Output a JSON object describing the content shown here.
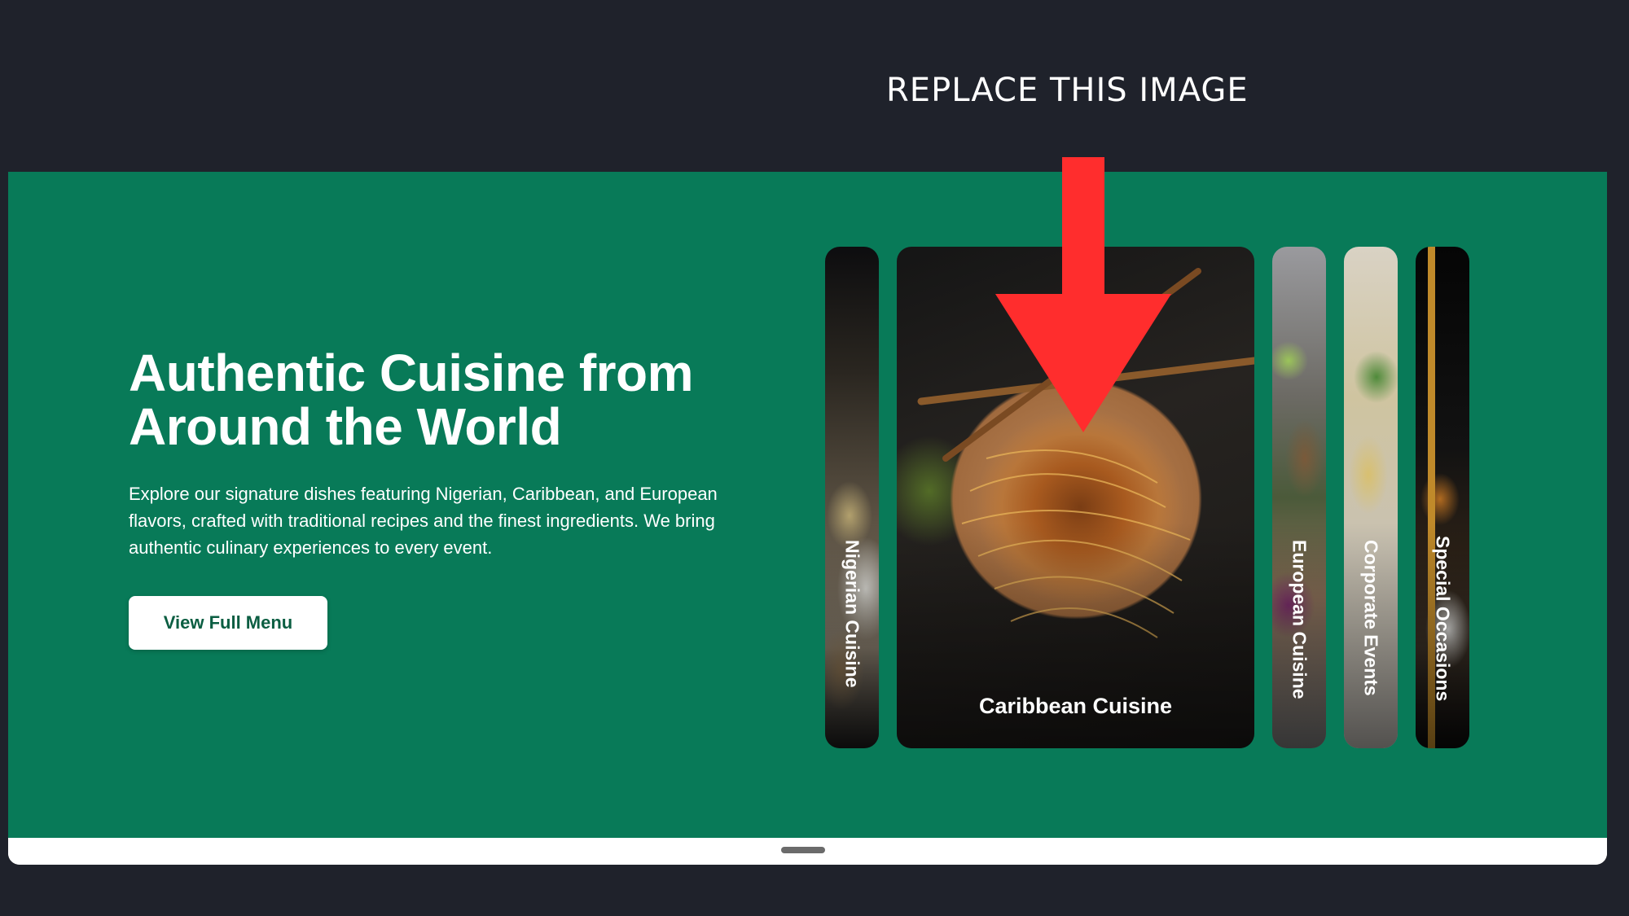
{
  "annotation": {
    "text": "REPLACE THIS IMAGE",
    "arrow_color": "#ff2d2d"
  },
  "hero": {
    "background": "#087a58",
    "title": "Authentic Cuisine from Around the World",
    "description": "Explore our signature dishes featuring Nigerian, Caribbean, and European flavors, crafted with traditional recipes and the finest ingredients. We bring authentic culinary experiences to every event.",
    "button_label": "View Full Menu"
  },
  "cards": [
    {
      "label": "Nigerian Cuisine",
      "expanded": false
    },
    {
      "label": "Caribbean Cuisine",
      "expanded": true
    },
    {
      "label": "European Cuisine",
      "expanded": false
    },
    {
      "label": "Corporate Events",
      "expanded": false
    },
    {
      "label": "Special Occasions",
      "expanded": false
    }
  ]
}
